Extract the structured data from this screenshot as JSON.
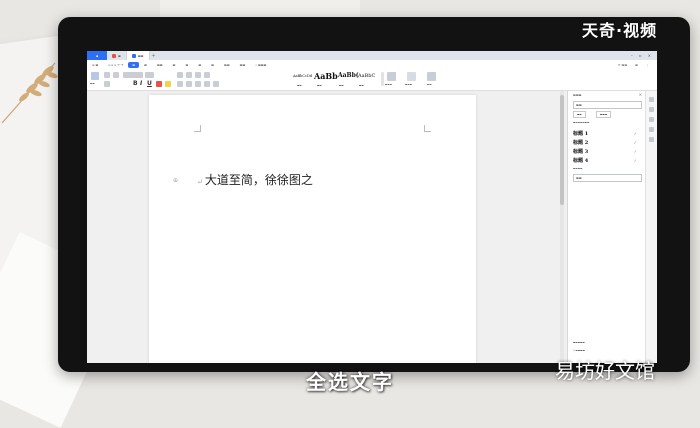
{
  "overlay": {
    "logo": "天奇·视频",
    "caption": "全选文字",
    "watermark": "易坊好文馆"
  },
  "document": {
    "text": "大道至简，徐徐图之"
  },
  "styles_pane": {
    "items": [
      {
        "label": "标题 1"
      },
      {
        "label": "标题 2"
      },
      {
        "label": "标题 3"
      },
      {
        "label": "标题 4"
      }
    ]
  },
  "ribbon": {
    "bold": "B",
    "italic": "I",
    "underline": "U",
    "style_previews": [
      "AaBbCcDd",
      "AaBb",
      "AaBb(",
      "AaBbC"
    ]
  },
  "colors": {
    "accent": "#2f6ff1",
    "bezel": "#121212",
    "page": "#ffffff"
  }
}
